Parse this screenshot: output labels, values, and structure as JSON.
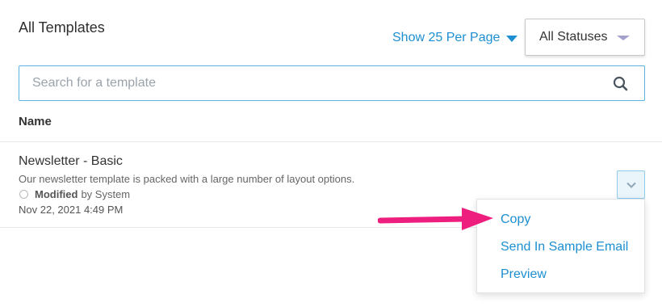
{
  "header": {
    "title": "All Templates",
    "per_page_label": "Show 25 Per Page",
    "status_filter": "All Statuses"
  },
  "search": {
    "placeholder": "Search for a template",
    "value": ""
  },
  "table": {
    "column_header": "Name",
    "rows": [
      {
        "title": "Newsletter - Basic",
        "description": "Our newsletter template is packed with a large number of layout options.",
        "modified_label": "Modified",
        "modified_by": "by System",
        "date": "Nov 22, 2021 4:49 PM"
      }
    ]
  },
  "row_menu": {
    "items": [
      "Copy",
      "Send In Sample Email",
      "Preview"
    ]
  },
  "colors": {
    "accent": "#1d8fd1",
    "search_border": "#5cb3e0",
    "annotation_arrow": "#ee1e7f",
    "status_caret": "#a3a0cc"
  },
  "icons": {
    "per_page_caret": "caret-down-icon",
    "status_caret": "caret-down-icon",
    "search": "search-icon",
    "row_toggle": "chevron-down-icon",
    "row_status": "status-circle-icon",
    "annotation": "arrow-right-icon"
  }
}
